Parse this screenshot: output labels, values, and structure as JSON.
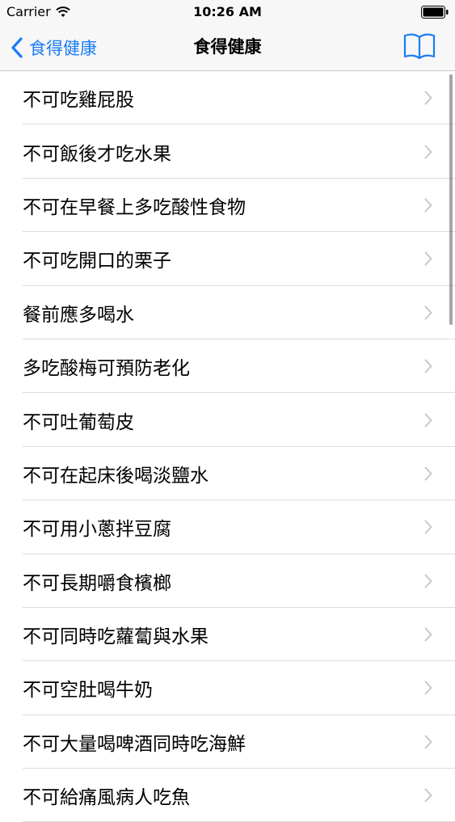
{
  "status_bar": {
    "carrier": "Carrier",
    "time": "10:26 AM"
  },
  "nav": {
    "back_label": "食得健康",
    "title": "食得健康"
  },
  "colors": {
    "accent": "#1a7cf5",
    "bar_background": "#f7f7f7",
    "separator": "#dcdcdf",
    "chevron": "#c7c7cc"
  },
  "icons": {
    "wifi": "wifi-icon",
    "battery": "battery-icon",
    "back": "chevron-left-icon",
    "book": "book-icon",
    "disclosure": "chevron-right-icon"
  },
  "list": {
    "items": [
      "不可吃雞屁股",
      "不可飯後才吃水果",
      "不可在早餐上多吃酸性食物",
      "不可吃開口的栗子",
      "餐前應多喝水",
      "多吃酸梅可預防老化",
      "不可吐葡萄皮",
      "不可在起床後喝淡鹽水",
      "不可用小蔥拌豆腐",
      "不可長期嚼食檳榔",
      "不可同時吃蘿蔔與水果",
      "不可空肚喝牛奶",
      "不可大量喝啤酒同時吃海鮮",
      "不可給痛風病人吃魚"
    ]
  }
}
